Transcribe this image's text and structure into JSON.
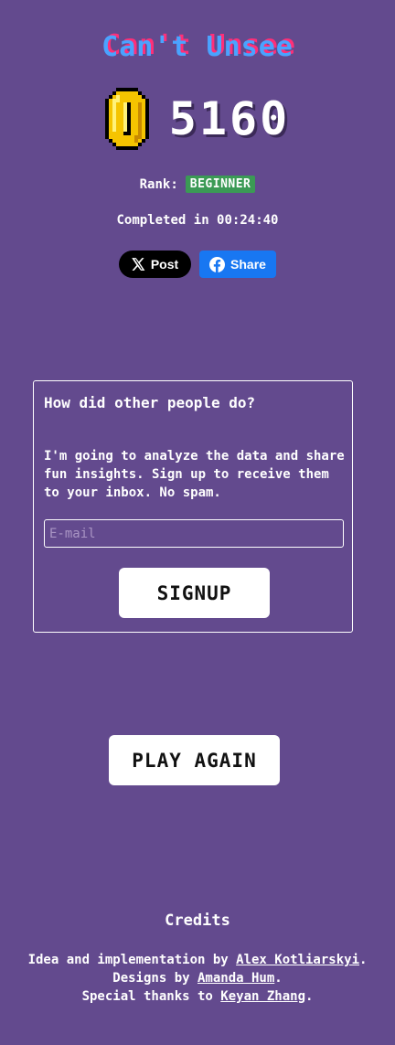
{
  "header": {
    "title": "Can't Unsee"
  },
  "score": {
    "value": "5160",
    "icon": "coin-icon"
  },
  "rank": {
    "label": "Rank:",
    "value": "BEGINNER"
  },
  "completed": {
    "text": "Completed in 00:24:40"
  },
  "share": {
    "x_label": "Post",
    "facebook_label": "Share"
  },
  "signup": {
    "heading": "How did other people do?",
    "text": "I'm going to analyze the data and share fun insights. Sign up to receive them to your inbox. No spam.",
    "email_placeholder": "E-mail",
    "button_label": "SIGNUP"
  },
  "play_again": {
    "label": "PLAY AGAIN"
  },
  "credits": {
    "title": "Credits",
    "line1_prefix": "Idea and implementation by ",
    "line1_link": "Alex Kotliarskyi",
    "line1_suffix": ".",
    "line2_prefix": "Designs by ",
    "line2_link": "Amanda Hum",
    "line2_suffix": ".",
    "line3_prefix": "Special thanks to ",
    "line3_link": "Keyan Zhang",
    "line3_suffix": "."
  },
  "colors": {
    "background": "#634a8e",
    "title_blue": "#4aa3ff",
    "title_pink": "#ff2f78",
    "rank_badge": "#3b9a55",
    "facebook": "#1877f2",
    "coin_gold": "#f5c400"
  }
}
